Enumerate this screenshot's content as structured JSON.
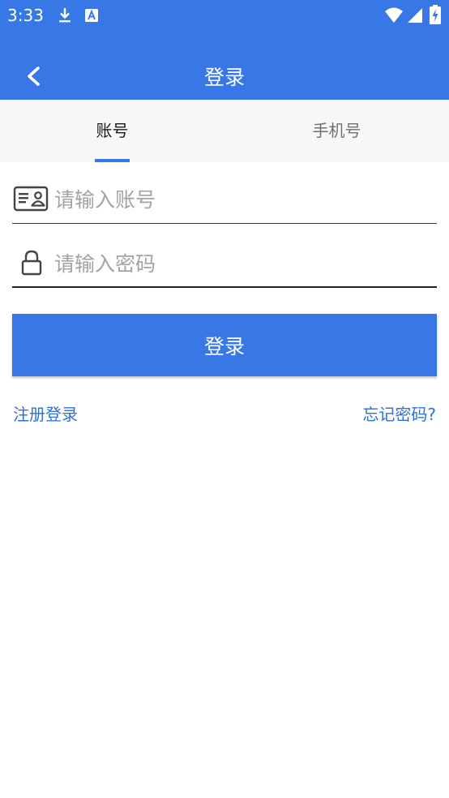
{
  "status_bar": {
    "time": "3:33",
    "icons": [
      "download-icon",
      "a-notification-icon",
      "wifi-icon",
      "signal-icon",
      "battery-charging-icon"
    ]
  },
  "toolbar": {
    "title": "登录",
    "back_icon": "chevron-left-icon"
  },
  "tabs": [
    {
      "label": "账号",
      "selected": true
    },
    {
      "label": "手机号",
      "selected": false
    }
  ],
  "form": {
    "account": {
      "placeholder": "请输入账号",
      "value": "",
      "icon": "id-card-icon"
    },
    "password": {
      "placeholder": "请输入密码",
      "value": "",
      "icon": "lock-icon"
    },
    "submit_label": "登录"
  },
  "links": {
    "register": "注册登录",
    "forgot": "忘记密码?"
  },
  "colors": {
    "primary": "#3778E6",
    "link": "#2E70D9",
    "tab_bar_bg": "#F7F7F7",
    "placeholder": "#A3A3A3"
  }
}
